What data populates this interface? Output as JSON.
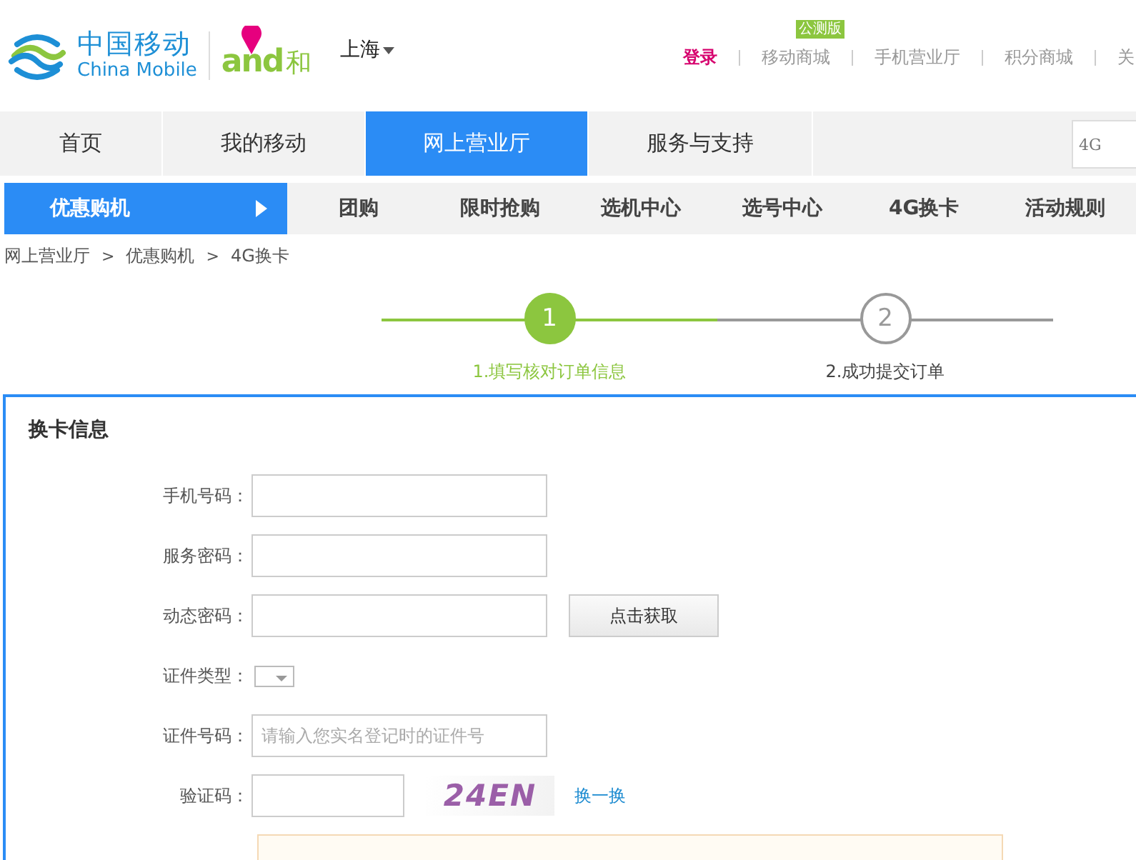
{
  "header": {
    "brand_cn": "中国移动",
    "brand_en": "China Mobile",
    "brand2_latin": "and",
    "brand2_cn": "和",
    "city": "上海",
    "badge": "公测版",
    "links": [
      {
        "label": "登录",
        "kind": "login"
      },
      {
        "label": "移动商城",
        "kind": "link"
      },
      {
        "label": "手机营业厅",
        "kind": "link"
      },
      {
        "label": "积分商城",
        "kind": "link"
      },
      {
        "label": "关",
        "kind": "link"
      }
    ]
  },
  "nav": {
    "items": [
      {
        "label": "首页",
        "selected": false
      },
      {
        "label": "我的移动",
        "selected": false
      },
      {
        "label": "网上营业厅",
        "selected": true
      },
      {
        "label": "服务与支持",
        "selected": false
      }
    ],
    "search": {
      "placeholder": "4G"
    }
  },
  "subnav": [
    {
      "label": "优惠购机",
      "selected": true
    },
    {
      "label": "团购",
      "selected": false
    },
    {
      "label": "限时抢购",
      "selected": false
    },
    {
      "label": "选机中心",
      "selected": false
    },
    {
      "label": "选号中心",
      "selected": false
    },
    {
      "label": "4G换卡",
      "selected": false
    },
    {
      "label": "活动规则",
      "selected": false
    }
  ],
  "breadcrumb": {
    "separator": ">",
    "items": [
      "网上营业厅",
      "优惠购机",
      "4G换卡"
    ]
  },
  "steps": [
    {
      "number": "1",
      "label": "1.填写核对订单信息",
      "selected": true
    },
    {
      "number": "2",
      "label": "2.成功提交订单",
      "selected": false
    }
  ],
  "panel": {
    "title": "换卡信息",
    "fields": [
      {
        "label": "手机号码：",
        "kind": "text"
      },
      {
        "label": "服务密码：",
        "kind": "text"
      },
      {
        "label": "动态密码：",
        "kind": "sms",
        "button": "点击获取"
      },
      {
        "label": "证件类型：",
        "kind": "select"
      },
      {
        "label": "证件号码：",
        "kind": "text",
        "placeholder": "请输入您实名登记时的证件号"
      },
      {
        "label": "验证码：",
        "kind": "captcha",
        "captcha": "24EN",
        "refresh": "换一换"
      }
    ]
  }
}
